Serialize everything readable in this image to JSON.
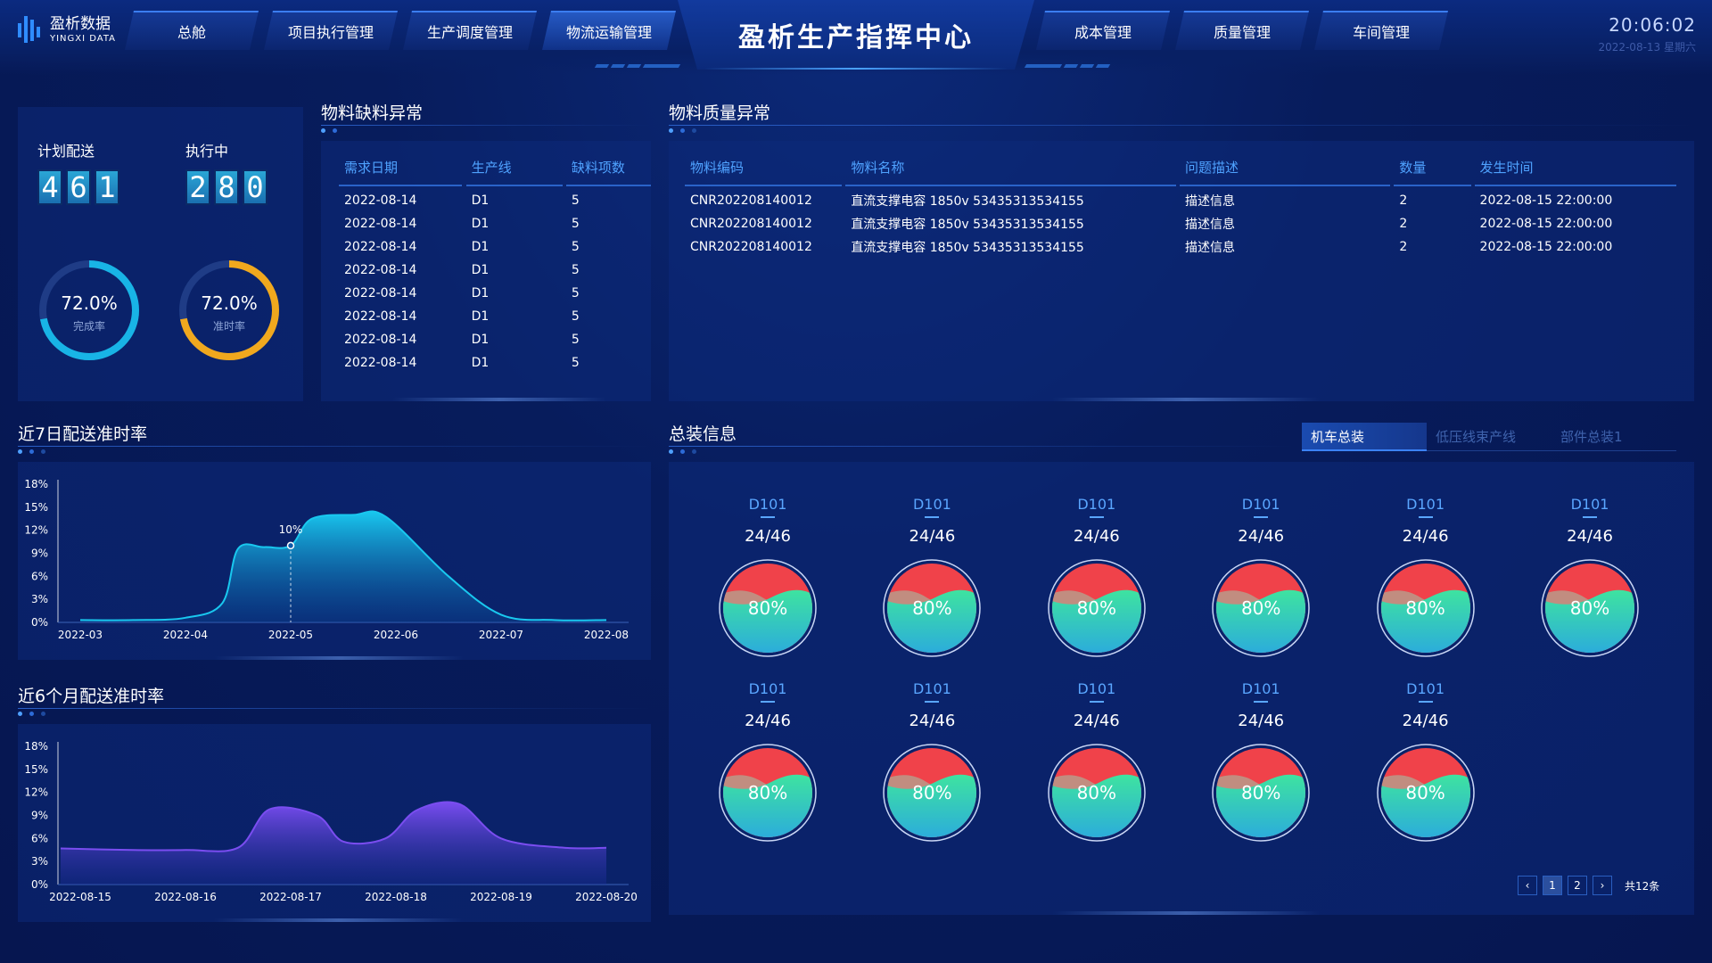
{
  "header": {
    "logo_cn": "盈析数据",
    "logo_en": "YINGXI DATA",
    "title": "盈析生产指挥中心",
    "nav_left": [
      "总舱",
      "项目执行管理",
      "生产调度管理",
      "物流运输管理"
    ],
    "nav_right": [
      "成本管理",
      "质量管理",
      "车间管理"
    ],
    "active_nav": "物流运输管理",
    "time": "20:06:02",
    "date": "2022-08-13 星期六"
  },
  "kpi": {
    "planned_label": "计划配送",
    "planned_digits": [
      "4",
      "6",
      "1"
    ],
    "running_label": "执行中",
    "running_digits": [
      "2",
      "8",
      "0"
    ],
    "completion": {
      "value": "72.0%",
      "label": "完成率",
      "fraction": 0.72,
      "color": "#18b4e6"
    },
    "ontime": {
      "value": "72.0%",
      "label": "准时率",
      "fraction": 0.72,
      "color": "#f0a81e"
    }
  },
  "shortage": {
    "title": "物料缺料异常",
    "headers": [
      "需求日期",
      "生产线",
      "缺料项数"
    ],
    "rows": [
      [
        "2022-08-14",
        "D1",
        "5"
      ],
      [
        "2022-08-14",
        "D1",
        "5"
      ],
      [
        "2022-08-14",
        "D1",
        "5"
      ],
      [
        "2022-08-14",
        "D1",
        "5"
      ],
      [
        "2022-08-14",
        "D1",
        "5"
      ],
      [
        "2022-08-14",
        "D1",
        "5"
      ],
      [
        "2022-08-14",
        "D1",
        "5"
      ],
      [
        "2022-08-14",
        "D1",
        "5"
      ]
    ]
  },
  "quality": {
    "title": "物料质量异常",
    "headers": [
      "物料编码",
      "物料名称",
      "问题描述",
      "数量",
      "发生时间"
    ],
    "rows": [
      [
        "CNR202208140012",
        "直流支撑电容 1850v 53435313534155",
        "描述信息",
        "2",
        "2022-08-15 22:00:00"
      ],
      [
        "CNR202208140012",
        "直流支撑电容 1850v 53435313534155",
        "描述信息",
        "2",
        "2022-08-15 22:00:00"
      ],
      [
        "CNR202208140012",
        "直流支撑电容 1850v 53435313534155",
        "描述信息",
        "2",
        "2022-08-15 22:00:00"
      ]
    ]
  },
  "assembly": {
    "title": "总装信息",
    "tabs": [
      "机车总装",
      "低压线束产线",
      "部件总装1"
    ],
    "active_tab": "机车总装",
    "items": [
      {
        "code": "D101",
        "ratio": "24/46",
        "pct": "80%"
      },
      {
        "code": "D101",
        "ratio": "24/46",
        "pct": "80%"
      },
      {
        "code": "D101",
        "ratio": "24/46",
        "pct": "80%"
      },
      {
        "code": "D101",
        "ratio": "24/46",
        "pct": "80%"
      },
      {
        "code": "D101",
        "ratio": "24/46",
        "pct": "80%"
      },
      {
        "code": "D101",
        "ratio": "24/46",
        "pct": "80%"
      },
      {
        "code": "D101",
        "ratio": "24/46",
        "pct": "80%"
      },
      {
        "code": "D101",
        "ratio": "24/46",
        "pct": "80%"
      },
      {
        "code": "D101",
        "ratio": "24/46",
        "pct": "80%"
      },
      {
        "code": "D101",
        "ratio": "24/46",
        "pct": "80%"
      },
      {
        "code": "D101",
        "ratio": "24/46",
        "pct": "80%"
      }
    ],
    "pager": {
      "pages": [
        "1",
        "2"
      ],
      "active": "1",
      "total": "共12条"
    }
  },
  "chart_data": [
    {
      "type": "area",
      "title": "近7日配送准时率",
      "x": [
        "2022-03",
        "2022-04",
        "2022-05",
        "2022-06",
        "2022-07",
        "2022-08"
      ],
      "y_ticks": [
        "0%",
        "3%",
        "6%",
        "9%",
        "12%",
        "15%",
        "18%"
      ],
      "ylim": [
        0,
        18
      ],
      "series": [
        {
          "values": [
            [
              0,
              0.3
            ],
            [
              0.5,
              0.3
            ],
            [
              1,
              0.6
            ],
            [
              1.35,
              2.5
            ],
            [
              1.5,
              9.6
            ],
            [
              1.75,
              9.8
            ],
            [
              2.0,
              10.0
            ],
            [
              2.2,
              13.5
            ],
            [
              2.6,
              14.0
            ],
            [
              2.9,
              13.8
            ],
            [
              3.5,
              6.0
            ],
            [
              4.0,
              1.0
            ],
            [
              4.5,
              0.3
            ],
            [
              5,
              0.3
            ]
          ]
        }
      ],
      "annotation": {
        "x": 2.0,
        "y": 10.0,
        "label": "10%"
      },
      "color_top": "#19c8ef",
      "color_bottom": "#0a4a9a"
    },
    {
      "type": "area",
      "title": "近6个月配送准时率",
      "x": [
        "2022-08-15",
        "2022-08-16",
        "2022-08-17",
        "2022-08-18",
        "2022-08-19",
        "2022-08-20"
      ],
      "y_ticks": [
        "0%",
        "3%",
        "6%",
        "9%",
        "12%",
        "15%",
        "18%"
      ],
      "ylim": [
        0,
        18
      ],
      "series": [
        {
          "values": [
            [
              -0.35,
              4.7
            ],
            [
              0.5,
              4.5
            ],
            [
              1,
              4.5
            ],
            [
              1.5,
              4.8
            ],
            [
              1.8,
              9.8
            ],
            [
              2.25,
              9.0
            ],
            [
              2.5,
              5.6
            ],
            [
              2.9,
              6.0
            ],
            [
              3.2,
              9.7
            ],
            [
              3.6,
              10.5
            ],
            [
              4.0,
              6.0
            ],
            [
              4.6,
              4.8
            ],
            [
              5,
              4.8
            ]
          ]
        }
      ],
      "color_top": "#7a4df0",
      "color_bottom": "#1b2d9a"
    }
  ]
}
